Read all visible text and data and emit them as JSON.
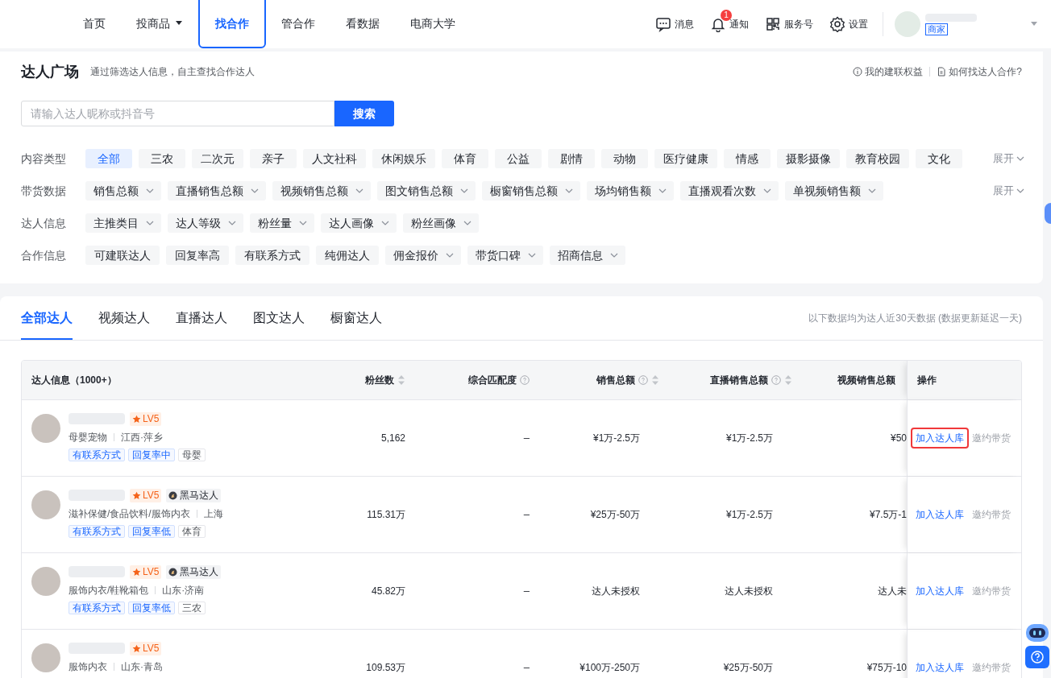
{
  "nav": {
    "items": [
      {
        "label": "首页",
        "selected": false,
        "dropdown": false
      },
      {
        "label": "投商品",
        "selected": false,
        "dropdown": true
      },
      {
        "label": "找合作",
        "selected": true,
        "dropdown": false
      },
      {
        "label": "管合作",
        "selected": false,
        "dropdown": false
      },
      {
        "label": "看数据",
        "selected": false,
        "dropdown": false
      },
      {
        "label": "电商大学",
        "selected": false,
        "dropdown": false
      }
    ],
    "actions": [
      {
        "kind": "message",
        "label": "消息"
      },
      {
        "kind": "bell",
        "label": "通知",
        "badge": "1"
      },
      {
        "kind": "grid",
        "label": "服务号"
      },
      {
        "kind": "gear",
        "label": "设置"
      }
    ],
    "user": {
      "role": "商家"
    }
  },
  "header": {
    "title": "达人广场",
    "subtitle": "通过筛选达人信息，自主查找合作达人",
    "links": [
      {
        "kind": "info",
        "label": "我的建联权益"
      },
      {
        "kind": "doc",
        "label": "如何找达人合作?"
      }
    ]
  },
  "search": {
    "placeholder": "请输入达人昵称或抖音号",
    "button": "搜索"
  },
  "filters": [
    {
      "label": "内容类型",
      "expand": "展开",
      "options": [
        {
          "label": "全部",
          "selected": true,
          "dropdown": false
        },
        {
          "label": "三农",
          "selected": false,
          "dropdown": false
        },
        {
          "label": "二次元",
          "selected": false,
          "dropdown": false
        },
        {
          "label": "亲子",
          "selected": false,
          "dropdown": false
        },
        {
          "label": "人文社科",
          "selected": false,
          "dropdown": false
        },
        {
          "label": "休闲娱乐",
          "selected": false,
          "dropdown": false
        },
        {
          "label": "体育",
          "selected": false,
          "dropdown": false
        },
        {
          "label": "公益",
          "selected": false,
          "dropdown": false
        },
        {
          "label": "剧情",
          "selected": false,
          "dropdown": false
        },
        {
          "label": "动物",
          "selected": false,
          "dropdown": false
        },
        {
          "label": "医疗健康",
          "selected": false,
          "dropdown": false
        },
        {
          "label": "情感",
          "selected": false,
          "dropdown": false
        },
        {
          "label": "摄影摄像",
          "selected": false,
          "dropdown": false
        },
        {
          "label": "教育校园",
          "selected": false,
          "dropdown": false
        },
        {
          "label": "文化",
          "selected": false,
          "dropdown": false
        }
      ]
    },
    {
      "label": "带货数据",
      "expand": "展开",
      "options": [
        {
          "label": "销售总额",
          "selected": false,
          "dropdown": true
        },
        {
          "label": "直播销售总额",
          "selected": false,
          "dropdown": true
        },
        {
          "label": "视频销售总额",
          "selected": false,
          "dropdown": true
        },
        {
          "label": "图文销售总额",
          "selected": false,
          "dropdown": true
        },
        {
          "label": "橱窗销售总额",
          "selected": false,
          "dropdown": true
        },
        {
          "label": "场均销售额",
          "selected": false,
          "dropdown": true
        },
        {
          "label": "直播观看次数",
          "selected": false,
          "dropdown": true
        },
        {
          "label": "单视频销售额",
          "selected": false,
          "dropdown": true
        }
      ]
    },
    {
      "label": "达人信息",
      "options": [
        {
          "label": "主推类目",
          "selected": false,
          "dropdown": true
        },
        {
          "label": "达人等级",
          "selected": false,
          "dropdown": true
        },
        {
          "label": "粉丝量",
          "selected": false,
          "dropdown": true
        },
        {
          "label": "达人画像",
          "selected": false,
          "dropdown": true
        },
        {
          "label": "粉丝画像",
          "selected": false,
          "dropdown": true
        }
      ]
    },
    {
      "label": "合作信息",
      "options": [
        {
          "label": "可建联达人",
          "selected": false,
          "dropdown": false
        },
        {
          "label": "回复率高",
          "selected": false,
          "dropdown": false
        },
        {
          "label": "有联系方式",
          "selected": false,
          "dropdown": false
        },
        {
          "label": "纯佣达人",
          "selected": false,
          "dropdown": false
        },
        {
          "label": "佣金报价",
          "selected": false,
          "dropdown": true
        },
        {
          "label": "带货口碑",
          "selected": false,
          "dropdown": true
        },
        {
          "label": "招商信息",
          "selected": false,
          "dropdown": true
        }
      ]
    }
  ],
  "tabs": [
    {
      "label": "全部达人",
      "selected": true
    },
    {
      "label": "视频达人",
      "selected": false
    },
    {
      "label": "直播达人",
      "selected": false
    },
    {
      "label": "图文达人",
      "selected": false
    },
    {
      "label": "橱窗达人",
      "selected": false
    }
  ],
  "note": "以下数据均为达人近30天数据 (数据更新延迟一天)",
  "table": {
    "columns": [
      {
        "label": "达人信息（1000+）",
        "sortable": false,
        "help": false
      },
      {
        "label": "粉丝数",
        "sortable": true,
        "help": false
      },
      {
        "label": "综合匹配度",
        "sortable": false,
        "help": true
      },
      {
        "label": "销售总额",
        "sortable": true,
        "help": true
      },
      {
        "label": "直播销售总额",
        "sortable": true,
        "help": true
      },
      {
        "label": "视频销售总额",
        "sortable": false,
        "help": false
      },
      {
        "label": "操作",
        "sortable": false,
        "help": false
      }
    ],
    "rows": [
      {
        "level": "LV5",
        "details": [
          "母婴宠物",
          "江西·萍乡"
        ],
        "tags": [
          {
            "label": "有联系方式",
            "accent": true
          },
          {
            "label": "回复率中",
            "accent": true
          },
          {
            "label": "母婴",
            "accent": false
          }
        ],
        "fans": "5,162",
        "match": "–",
        "sales": "¥1万-2.5万",
        "live": "¥1万-2.5万",
        "video": "¥50",
        "actions": [
          "加入达人库",
          "邀约带货"
        ],
        "highlighted": true
      },
      {
        "level": "LV5",
        "badge": "黑马达人",
        "details": [
          "滋补保健/食品饮料/服饰内衣",
          "上海"
        ],
        "tags": [
          {
            "label": "有联系方式",
            "accent": true
          },
          {
            "label": "回复率低",
            "accent": true
          },
          {
            "label": "体育",
            "accent": false
          }
        ],
        "fans": "115.31万",
        "match": "–",
        "sales": "¥25万-50万",
        "live": "¥1万-2.5万",
        "video": "¥7.5万-1",
        "actions": [
          "加入达人库",
          "邀约带货"
        ],
        "highlighted": false
      },
      {
        "level": "LV5",
        "badge": "黑马达人",
        "details": [
          "服饰内衣/鞋靴箱包",
          "山东·济南"
        ],
        "tags": [
          {
            "label": "有联系方式",
            "accent": true
          },
          {
            "label": "回复率低",
            "accent": true
          },
          {
            "label": "三农",
            "accent": false
          }
        ],
        "fans": "45.82万",
        "match": "–",
        "sales": "达人未授权",
        "live": "达人未授权",
        "video": "达人未",
        "actions": [
          "加入达人库",
          "邀约带货"
        ],
        "highlighted": false
      },
      {
        "level": "LV5",
        "details": [
          "服饰内衣",
          "山东·青岛"
        ],
        "fans": "109.53万",
        "match": "–",
        "sales": "¥100万-250万",
        "live": "¥25万-50万",
        "video": "¥75万-10",
        "actions": [
          "加入达人库",
          "邀约带货"
        ],
        "highlighted": false
      }
    ]
  }
}
